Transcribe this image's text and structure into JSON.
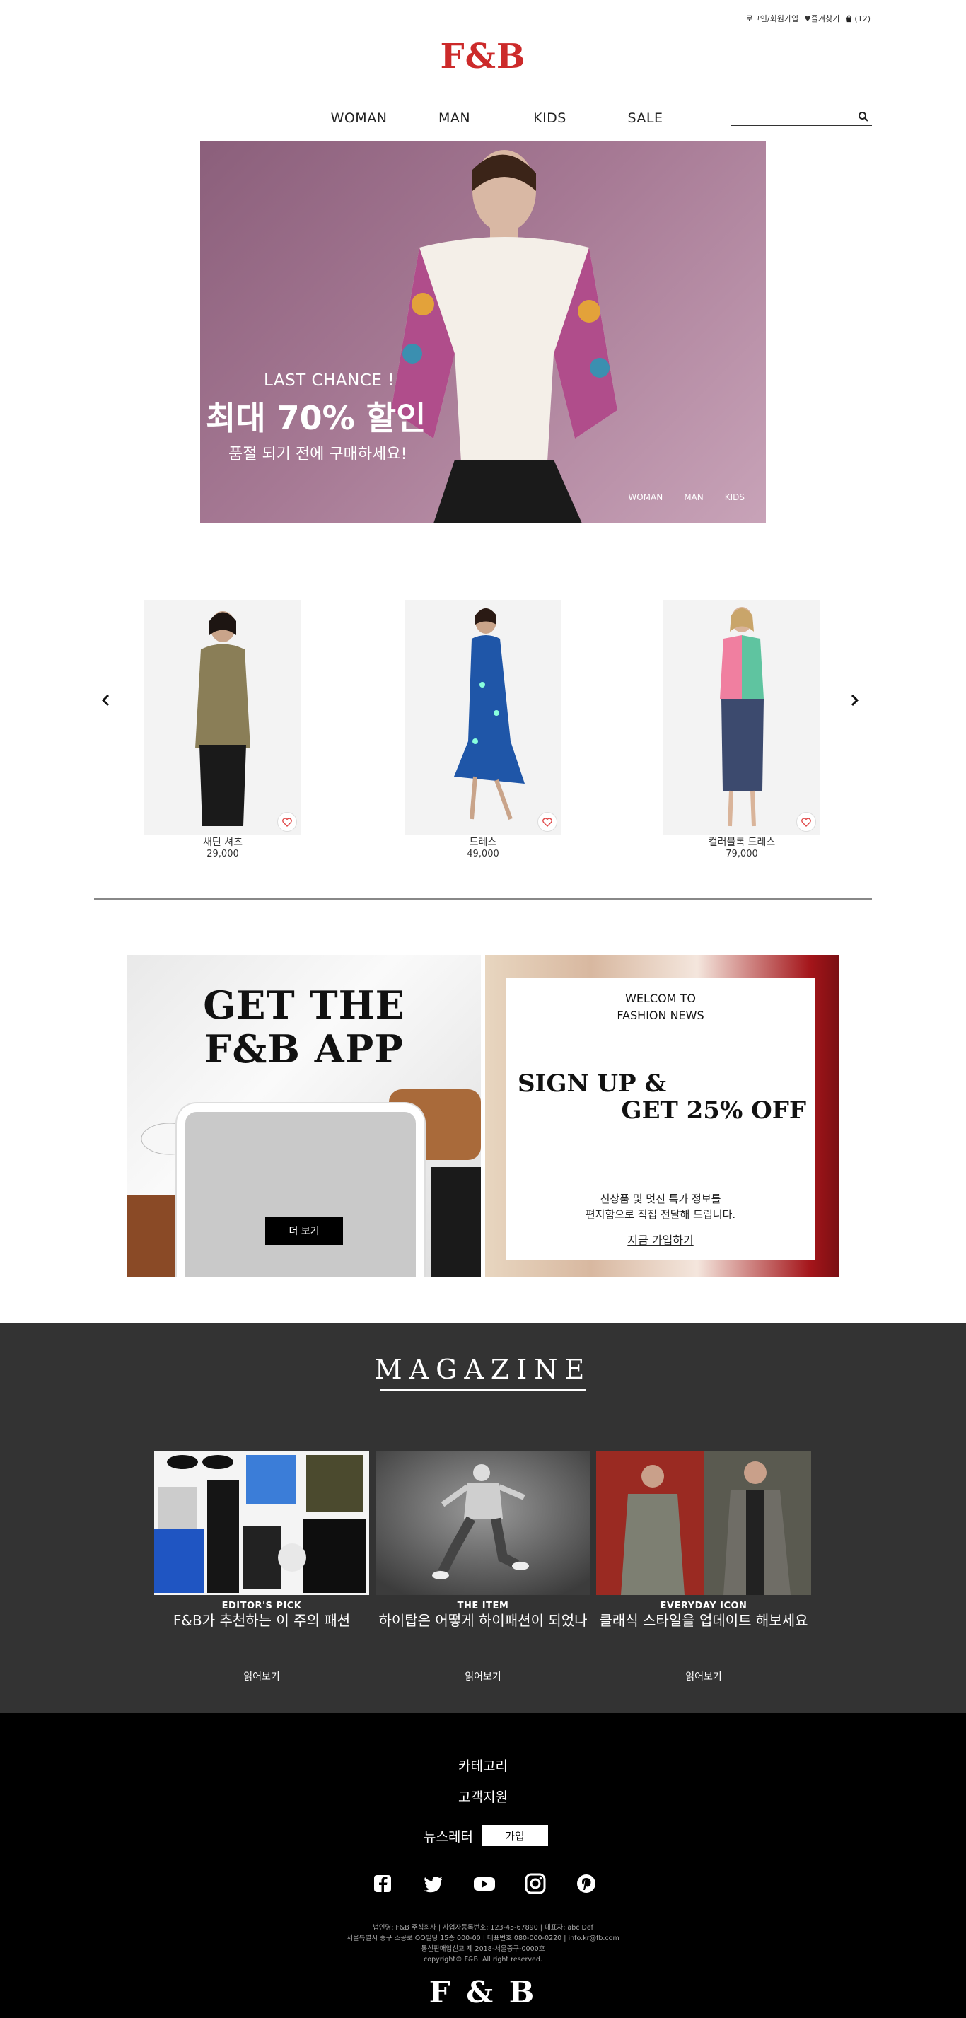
{
  "topbar": {
    "login": "로그인/회원가입",
    "favorites": "♥즐겨찾기",
    "cart": "(12)"
  },
  "brand": {
    "logo": "F&B",
    "accent": "#cc2a2a"
  },
  "nav": {
    "items": [
      "WOMAN",
      "MAN",
      "KIDS",
      "SALE"
    ],
    "search_placeholder": ""
  },
  "hero": {
    "line1": "LAST CHANCE !",
    "line2": "최대 70% 할인",
    "line3": "품절 되기 전에 구매하세요!",
    "links": [
      "WOMAN",
      "MAN",
      "KIDS"
    ]
  },
  "products": [
    {
      "name": "새틴 셔츠",
      "price": "29,000"
    },
    {
      "name": "드레스",
      "price": "49,000"
    },
    {
      "name": "컬러블록 드레스",
      "price": "79,000"
    }
  ],
  "promo_app": {
    "title_line1": "GET THE",
    "title_line2": "F&B APP",
    "button": "더 보기"
  },
  "promo_news": {
    "welcome_line1": "WELCOM TO",
    "welcome_line2": "FASHION NEWS",
    "signup_line1": "SIGN UP &",
    "signup_line2": "GET 25% OFF",
    "desc_line1": "신상품 및 멋진 특가 정보를",
    "desc_line2": "편지함으로 직접 전달해 드립니다.",
    "link": "지금 가입하기"
  },
  "magazine": {
    "title": "MAGAZINE",
    "articles": [
      {
        "category": "EDITOR'S PICK",
        "headline": "F&B가 추천하는 이 주의 패션",
        "read": "읽어보기"
      },
      {
        "category": "THE ITEM",
        "headline": "하이탑은 어떻게 하이패션이 되었나",
        "read": "읽어보기"
      },
      {
        "category": "EVERYDAY ICON",
        "headline": "클래식 스타일을 업데이트 해보세요",
        "read": "읽어보기"
      }
    ]
  },
  "footer": {
    "category": "카테고리",
    "support": "고객지원",
    "newsletter": "뉴스레터",
    "join": "가입",
    "info_line1": "법인명: F&B 주식회사 | 사업자등록번호: 123-45-67890 | 대표자: abc Def",
    "info_line2": "서울특별시 중구 소공로 OO빌딩 15층 000-00 | 대표번호 080-000-0220 | info.kr@fb.com",
    "info_line3": "통신판매업신고 제 2018-서울중구-0000호",
    "info_line4": "copyright© F&B. All right reserved.",
    "logo": "F & B"
  }
}
